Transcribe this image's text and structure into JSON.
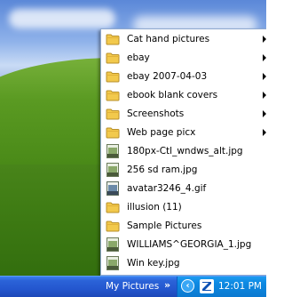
{
  "menu": {
    "items": [
      {
        "label": "Cat hand pictures",
        "icon": "folder-icon",
        "submenu": true
      },
      {
        "label": "ebay",
        "icon": "folder-icon",
        "submenu": true
      },
      {
        "label": "ebay 2007-04-03",
        "icon": "folder-icon",
        "submenu": true
      },
      {
        "label": "ebook blank covers",
        "icon": "folder-icon",
        "submenu": true
      },
      {
        "label": "Screenshots",
        "icon": "folder-icon",
        "submenu": true
      },
      {
        "label": "Web page picx",
        "icon": "folder-icon",
        "submenu": true
      },
      {
        "label": "180px-Ctl_wndws_alt.jpg",
        "icon": "jpg-file-icon",
        "submenu": false
      },
      {
        "label": "256 sd ram.jpg",
        "icon": "jpg-file-icon",
        "submenu": false
      },
      {
        "label": "avatar3246_4.gif",
        "icon": "gif-file-icon",
        "submenu": false
      },
      {
        "label": "illusion (11)",
        "icon": "folder-icon",
        "submenu": false
      },
      {
        "label": "Sample Pictures",
        "icon": "folder-icon",
        "submenu": false
      },
      {
        "label": "WILLIAMS^GEORGIA_1.jpg",
        "icon": "jpg-file-icon",
        "submenu": false
      },
      {
        "label": "Win key.jpg",
        "icon": "jpg-file-icon",
        "submenu": false
      }
    ]
  },
  "taskbar": {
    "toolbar_label": "My Pictures",
    "chevron": "»",
    "tray_expand": "‹",
    "tray_app_icon": "z-icon",
    "clock": "12:01 PM"
  },
  "colors": {
    "taskbar_blue": "#2457cf",
    "tray_blue": "#0b79d0",
    "folder_yellow": "#f2c94c",
    "menu_border": "#8ea8cf"
  }
}
